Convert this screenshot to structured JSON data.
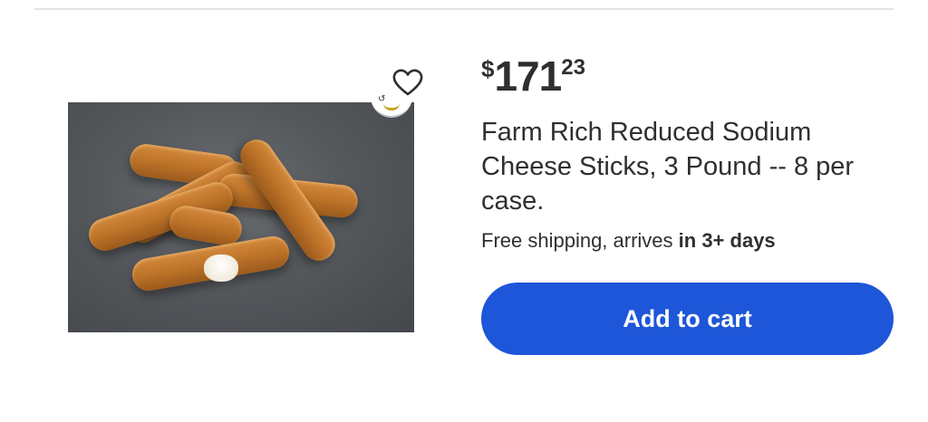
{
  "product": {
    "price": {
      "currency": "$",
      "dollars": "171",
      "cents": "23"
    },
    "title": "Farm Rich Reduced Sodium Cheese Sticks, 3 Pound -- 8 per case.",
    "shipping": {
      "prefix": "Free shipping, arrives ",
      "emphasis": "in 3+ days"
    },
    "favorite_icon": "heart-outline-icon",
    "badge_icon": "seller-badge-icon"
  },
  "actions": {
    "add_to_cart_label": "Add to cart"
  },
  "colors": {
    "accent": "#1e56d9",
    "text": "#2e2f32",
    "divider": "#e3e4e5"
  }
}
